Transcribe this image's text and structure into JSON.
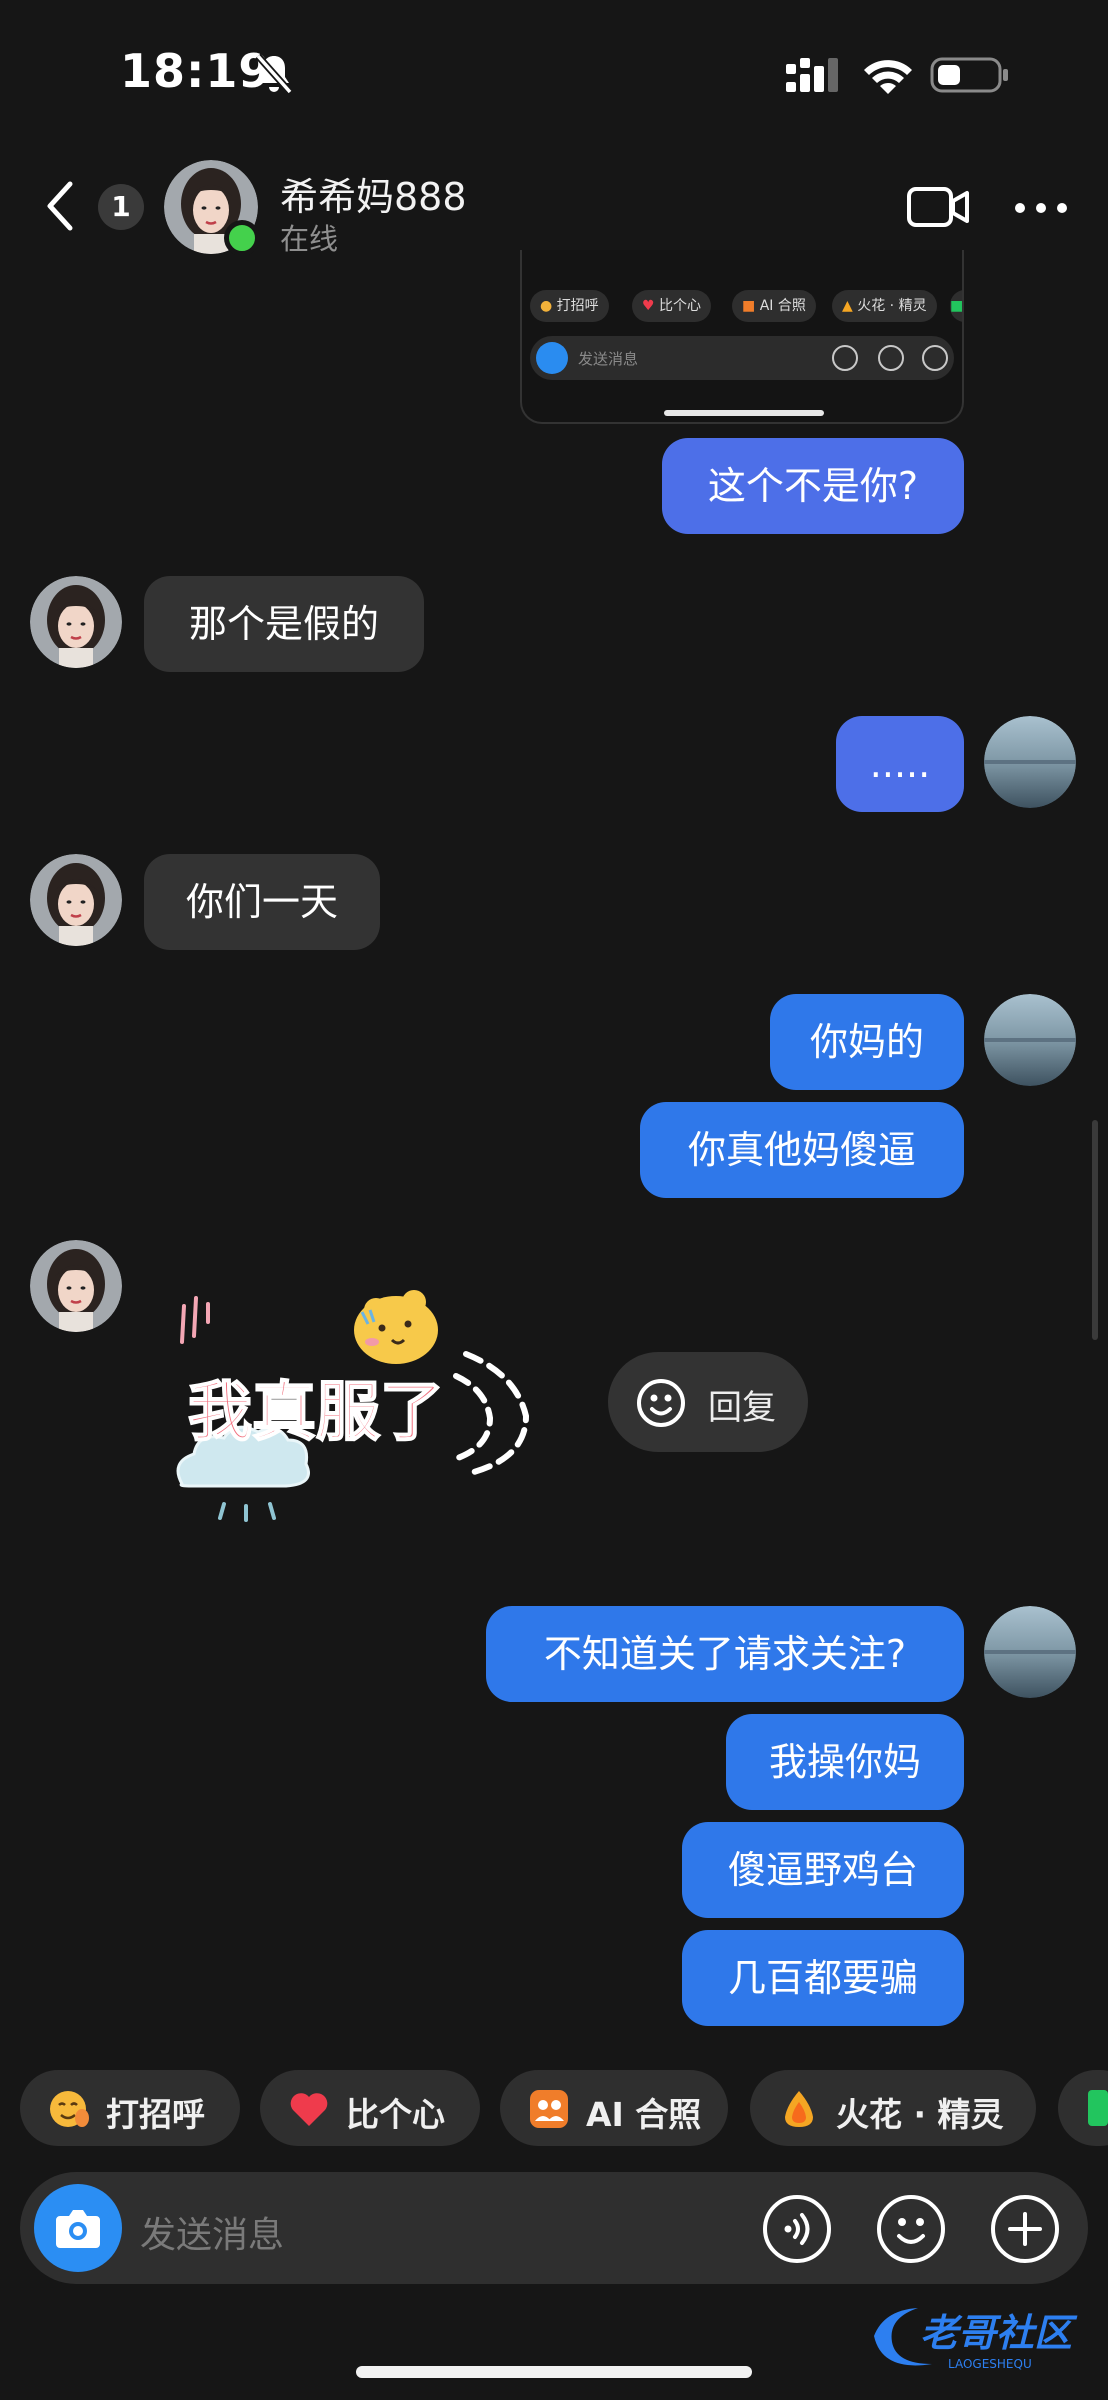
{
  "status_bar": {
    "time": "18:19",
    "icons": [
      "bell-off-icon",
      "signal-icon",
      "wifi-icon",
      "battery-icon"
    ]
  },
  "header": {
    "unread_count": "1",
    "contact_name": "希希妈888",
    "contact_status": "在线"
  },
  "shared_screenshot": {
    "chips": [
      "打招呼",
      "比个心",
      "AI 合照",
      "火花 · 精灵"
    ],
    "input_placeholder": "发送消息"
  },
  "messages": [
    {
      "from": "me",
      "text": "这个不是你?"
    },
    {
      "from": "them",
      "text": "那个是假的"
    },
    {
      "from": "me",
      "text": "....."
    },
    {
      "from": "them",
      "text": "你们一天"
    },
    {
      "from": "me",
      "text": "你妈的"
    },
    {
      "from": "me",
      "text": "你真他妈傻逼"
    },
    {
      "from": "them",
      "type": "sticker",
      "text": "我真服了"
    },
    {
      "from": "me",
      "text": "不知道关了请求关注?"
    },
    {
      "from": "me",
      "text": "我操你妈"
    },
    {
      "from": "me",
      "text": "傻逼野鸡台"
    },
    {
      "from": "me",
      "text": "几百都要骗"
    }
  ],
  "reply_button": {
    "label": "回复"
  },
  "quick_chips": [
    {
      "label": "打招呼",
      "icon": "wave-emoji-icon"
    },
    {
      "label": "比个心",
      "icon": "heart-icon"
    },
    {
      "label": "AI 合照",
      "icon": "ai-photo-icon"
    },
    {
      "label": "火花 · 精灵",
      "icon": "spark-sprite-icon"
    }
  ],
  "input": {
    "placeholder": "发送消息"
  },
  "watermark": {
    "text": "老哥社区",
    "subtext": "LAOGESHEQU"
  },
  "colors": {
    "background": "#161616",
    "outgoing_bubble": "#2f78ea",
    "incoming_bubble": "#333333",
    "online": "#44d14c",
    "camera_button": "#2b8ef3"
  }
}
